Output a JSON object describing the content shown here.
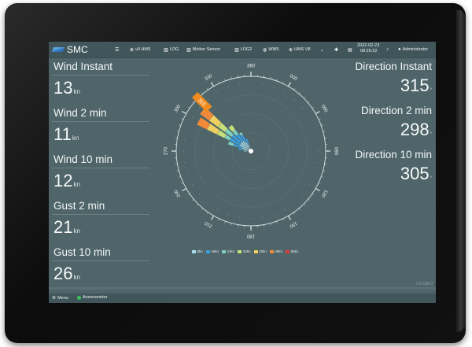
{
  "app": {
    "brand": "SMC"
  },
  "topbar": {
    "menu_icon": "menu-icon",
    "items": [
      {
        "icon": "plus-circle-icon",
        "label": "v9 HMS"
      },
      {
        "icon": "chart-icon",
        "label": "LOG"
      },
      {
        "icon": "chart-icon",
        "label": "Motion Sensor"
      },
      {
        "icon": "chart-icon",
        "label": "LOG2"
      },
      {
        "icon": "globe-icon",
        "label": "WMS"
      },
      {
        "icon": "plus-circle-icon",
        "label": "HMS V8"
      }
    ],
    "date": "2022-02-23",
    "time": "08:26:22",
    "user": "Administrator"
  },
  "left": [
    {
      "label": "Wind Instant",
      "value": "13",
      "unit": "kn"
    },
    {
      "label": "Wind 2 min",
      "value": "11",
      "unit": "kn"
    },
    {
      "label": "Wind 10 min",
      "value": "12",
      "unit": "kn"
    },
    {
      "label": "Gust 2 min",
      "value": "21",
      "unit": "kn"
    },
    {
      "label": "Gust 10 min",
      "value": "26",
      "unit": "kn"
    }
  ],
  "right": [
    {
      "label": "Direction Instant",
      "value": "315",
      "unit": "°"
    },
    {
      "label": "Direction 2 min",
      "value": "298",
      "unit": "°"
    },
    {
      "label": "Direction 10 min",
      "value": "305",
      "unit": "°"
    }
  ],
  "rose": {
    "tick_labels": [
      "360",
      "030",
      "060",
      "090",
      "120",
      "150",
      "180",
      "210",
      "240",
      "270",
      "300",
      "330"
    ],
    "marker_label": "315",
    "legend": [
      {
        "label": "8kn",
        "color": "#a8def0"
      },
      {
        "label": "16kn",
        "color": "#3a9fe0"
      },
      {
        "label": "24kn",
        "color": "#7ed0c0"
      },
      {
        "label": "32kn",
        "color": "#c8e07a"
      },
      {
        "label": "40kn",
        "color": "#f0d060"
      },
      {
        "label": "48kn",
        "color": "#f08a3a"
      },
      {
        "label": "56kn",
        "color": "#e03a3a"
      }
    ],
    "sectors": [
      {
        "dir": 300,
        "bands": [
          2,
          4,
          5,
          6.5,
          8.5,
          10.5
        ]
      },
      {
        "dir": 310,
        "bands": [
          2,
          4,
          5.5,
          7,
          9,
          11
        ]
      },
      {
        "dir": 320,
        "bands": [
          2,
          3.5,
          4.5,
          5.5
        ]
      },
      {
        "dir": 330,
        "bands": [
          1.5,
          3,
          3.5
        ]
      },
      {
        "dir": 290,
        "bands": [
          1.5,
          3,
          4
        ]
      },
      {
        "dir": 280,
        "bands": [
          1,
          2
        ]
      },
      {
        "dir": 340,
        "bands": [
          1,
          2
        ]
      },
      {
        "dir": 270,
        "bands": [
          1
        ]
      }
    ]
  },
  "bottombar": {
    "menu_label": "Menu",
    "status_label": "Anemometer",
    "version": "0.8.136.0"
  }
}
